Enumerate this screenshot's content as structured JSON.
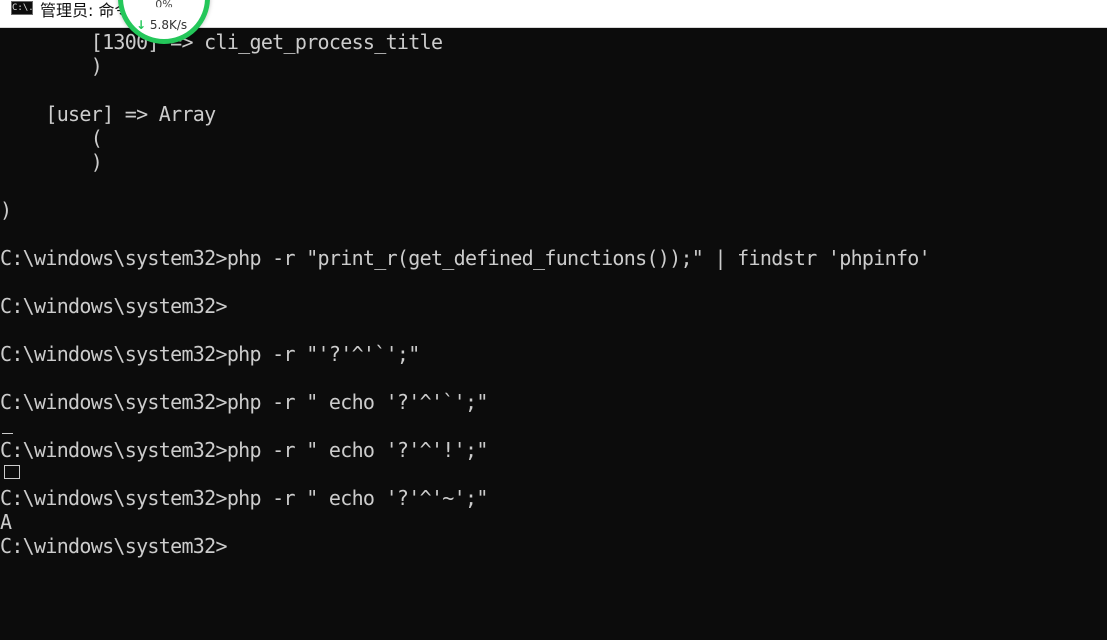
{
  "window": {
    "title": "管理员: 命令提示符",
    "icon": "cmd-icon",
    "icon_text": "C:\\."
  },
  "net_widget": {
    "percent": "0%",
    "speed": "5.8K/s",
    "arrow": "↓"
  },
  "console": {
    "lines": [
      "        [1300] => cli_get_process_title",
      "        )",
      "",
      "    [user] => Array",
      "        (",
      "        )",
      "",
      ")",
      "",
      "C:\\windows\\system32>php -r \"print_r(get_defined_functions());\" | findstr 'phpinfo'",
      "",
      "C:\\windows\\system32>",
      "",
      "C:\\windows\\system32>php -r \"'?'^'`';\"",
      "",
      "C:\\windows\\system32>php -r \" echo '?'^'`';\"",
      "",
      "C:\\windows\\system32>php -r \" echo '?'^'!';\"",
      "",
      "C:\\windows\\system32>php -r \" echo '?'^'~';\"",
      "A",
      "C:\\windows\\system32>"
    ]
  }
}
